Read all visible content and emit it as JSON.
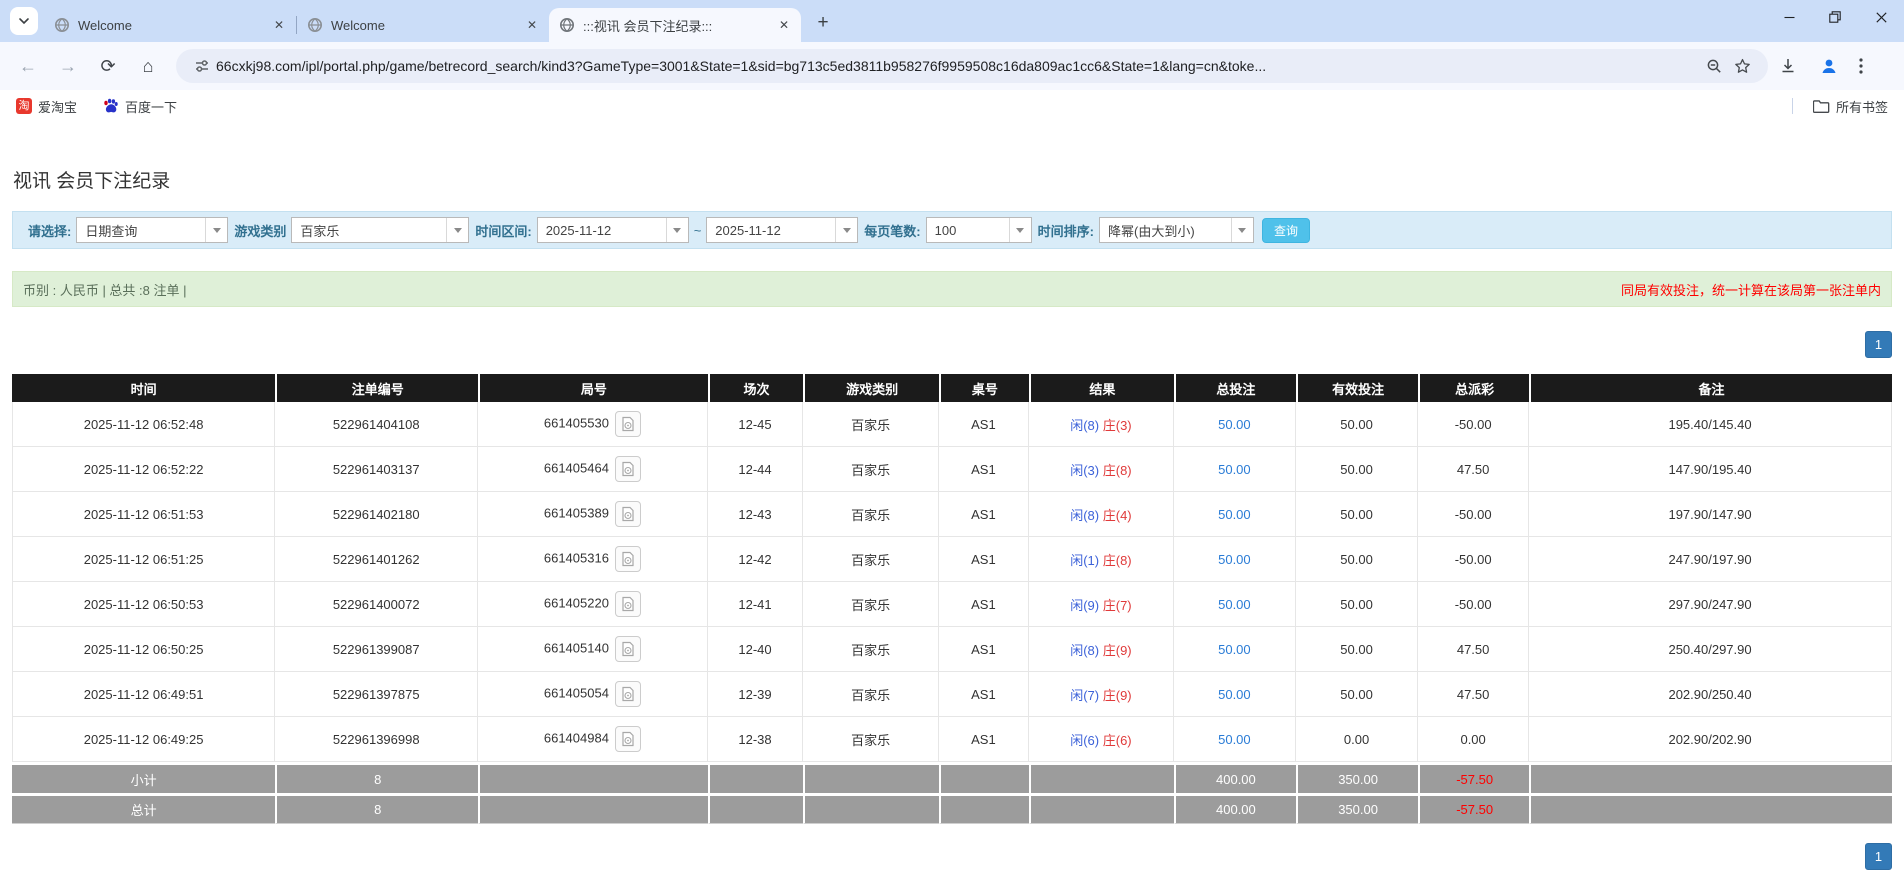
{
  "browser": {
    "tabs": [
      {
        "title": "Welcome"
      },
      {
        "title": "Welcome"
      },
      {
        "title": ":::视讯 会员下注纪录:::"
      }
    ],
    "new_tab_label": "+",
    "url": "66cxkj98.com/ipl/portal.php/game/betrecord_search/kind3?GameType=3001&State=1&sid=bg713c5ed3811b958276f9959508c16da809ac1cc6&State=1&lang=cn&toke...",
    "bookmarks": {
      "taobao": "爱淘宝",
      "baidu": "百度一下",
      "taobao_icon_char": "淘",
      "all_bookmarks": "所有书签"
    }
  },
  "page": {
    "title": "视讯 会员下注纪录",
    "filters": {
      "select_label": "请选择:",
      "select_value": "日期查询",
      "game_type_label": "游戏类别",
      "game_type_value": "百家乐",
      "date_range_label": "时间区间:",
      "date_from": "2025-11-12",
      "range_separator": "~",
      "date_to": "2025-11-12",
      "page_size_label": "每页笔数:",
      "page_size_value": "100",
      "sort_label": "时间排序:",
      "sort_value": "降幂(由大到小)",
      "search_button": "查询"
    },
    "summary": {
      "left": "币别 : 人民币 | 总共 :8 注单 |",
      "right": "同局有效投注，统一计算在该局第一张注单内"
    },
    "pagination": {
      "page": "1"
    },
    "table": {
      "headers": [
        "时间",
        "注单编号",
        "局号",
        "场次",
        "游戏类别",
        "桌号",
        "结果",
        "总投注",
        "有效投注",
        "总派彩",
        "备注"
      ],
      "col_widths": [
        "14%",
        "10.8%",
        "12.2%",
        "5.1%",
        "7.2%",
        "4.8%",
        "7.7%",
        "6.5%",
        "6.5%",
        "5.9%",
        "19.3%"
      ],
      "rows": [
        {
          "time": "2025-11-12 06:52:48",
          "bet_id": "522961404108",
          "round": "661405530",
          "session": "12-45",
          "game": "百家乐",
          "table": "AS1",
          "result_player": "闲(8)",
          "result_banker": "庄(3)",
          "total_bet": "50.00",
          "valid_bet": "50.00",
          "payout": "-50.00",
          "note": "195.40/145.40"
        },
        {
          "time": "2025-11-12 06:52:22",
          "bet_id": "522961403137",
          "round": "661405464",
          "session": "12-44",
          "game": "百家乐",
          "table": "AS1",
          "result_player": "闲(3)",
          "result_banker": "庄(8)",
          "total_bet": "50.00",
          "valid_bet": "50.00",
          "payout": "47.50",
          "note": "147.90/195.40"
        },
        {
          "time": "2025-11-12 06:51:53",
          "bet_id": "522961402180",
          "round": "661405389",
          "session": "12-43",
          "game": "百家乐",
          "table": "AS1",
          "result_player": "闲(8)",
          "result_banker": "庄(4)",
          "total_bet": "50.00",
          "valid_bet": "50.00",
          "payout": "-50.00",
          "note": "197.90/147.90"
        },
        {
          "time": "2025-11-12 06:51:25",
          "bet_id": "522961401262",
          "round": "661405316",
          "session": "12-42",
          "game": "百家乐",
          "table": "AS1",
          "result_player": "闲(1)",
          "result_banker": "庄(8)",
          "total_bet": "50.00",
          "valid_bet": "50.00",
          "payout": "-50.00",
          "note": "247.90/197.90"
        },
        {
          "time": "2025-11-12 06:50:53",
          "bet_id": "522961400072",
          "round": "661405220",
          "session": "12-41",
          "game": "百家乐",
          "table": "AS1",
          "result_player": "闲(9)",
          "result_banker": "庄(7)",
          "total_bet": "50.00",
          "valid_bet": "50.00",
          "payout": "-50.00",
          "note": "297.90/247.90"
        },
        {
          "time": "2025-11-12 06:50:25",
          "bet_id": "522961399087",
          "round": "661405140",
          "session": "12-40",
          "game": "百家乐",
          "table": "AS1",
          "result_player": "闲(8)",
          "result_banker": "庄(9)",
          "total_bet": "50.00",
          "valid_bet": "50.00",
          "payout": "47.50",
          "note": "250.40/297.90"
        },
        {
          "time": "2025-11-12 06:49:51",
          "bet_id": "522961397875",
          "round": "661405054",
          "session": "12-39",
          "game": "百家乐",
          "table": "AS1",
          "result_player": "闲(7)",
          "result_banker": "庄(9)",
          "total_bet": "50.00",
          "valid_bet": "50.00",
          "payout": "47.50",
          "note": "202.90/250.40"
        },
        {
          "time": "2025-11-12 06:49:25",
          "bet_id": "522961396998",
          "round": "661404984",
          "session": "12-38",
          "game": "百家乐",
          "table": "AS1",
          "result_player": "闲(6)",
          "result_banker": "庄(6)",
          "total_bet": "50.00",
          "valid_bet": "0.00",
          "payout": "0.00",
          "note": "202.90/202.90"
        }
      ],
      "subtotal": {
        "label": "小计",
        "count": "8",
        "total_bet": "400.00",
        "valid_bet": "350.00",
        "payout": "-57.50"
      },
      "total": {
        "label": "总计",
        "count": "8",
        "total_bet": "400.00",
        "valid_bet": "350.00",
        "payout": "-57.50"
      }
    }
  },
  "colors": {
    "accent_blue": "#337ab7",
    "search_button": "#4fc1ea",
    "filter_bg": "#d9ecf8",
    "summary_bg": "#dff0d8",
    "header_bg": "#1b1b1b",
    "footer_bg": "#9c9c9c",
    "negative": "#ff0000",
    "player_blue": "#3c62d9",
    "banker_red": "#e03a3a"
  }
}
